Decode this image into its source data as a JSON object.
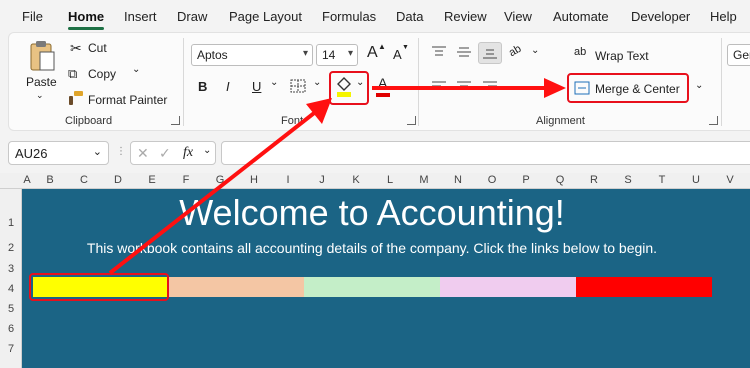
{
  "menu": {
    "items": [
      "File",
      "Home",
      "Insert",
      "Draw",
      "Page Layout",
      "Formulas",
      "Data",
      "Review",
      "View",
      "Automate",
      "Developer",
      "Help"
    ],
    "active": "Home"
  },
  "clipboard": {
    "paste_label": "Paste",
    "cut_label": "Cut",
    "copy_label": "Copy",
    "format_painter_label": "Format Painter",
    "group_label": "Clipboard"
  },
  "font": {
    "font_name": "Aptos",
    "font_size": "14",
    "bold": "B",
    "italic": "I",
    "underline": "U",
    "grow_label": "A",
    "shrink_label": "A",
    "font_color_label": "A",
    "group_label": "Font",
    "fill_color": "#f5f500",
    "font_color": "#e00000"
  },
  "alignment": {
    "wrap_text_label": "Wrap Text",
    "merge_center_label": "Merge & Center",
    "group_label": "Alignment",
    "orientation_label": "ab"
  },
  "number": {
    "format_value": "Ger"
  },
  "formula_bar": {
    "name_box": "AU26",
    "fx_label": "fx",
    "formula_value": ""
  },
  "grid": {
    "columns": [
      "A",
      "B",
      "C",
      "D",
      "E",
      "F",
      "G",
      "H",
      "I",
      "J",
      "K",
      "L",
      "M",
      "N",
      "O",
      "P",
      "Q",
      "R",
      "S",
      "T",
      "U",
      "V"
    ],
    "rows": [
      "1",
      "2",
      "3",
      "4",
      "5",
      "6",
      "7"
    ],
    "sheet_bg": "#1b6485"
  },
  "sheet": {
    "title": "Welcome to Accounting!",
    "subtitle": "This workbook contains all accounting details of the company. Click the links below to begin.",
    "band_colors": [
      "#ffff00",
      "#f4c6a4",
      "#c4eec8",
      "#f0ccef",
      "#ff0000"
    ]
  },
  "annotation": {
    "color": "#ff1010"
  }
}
